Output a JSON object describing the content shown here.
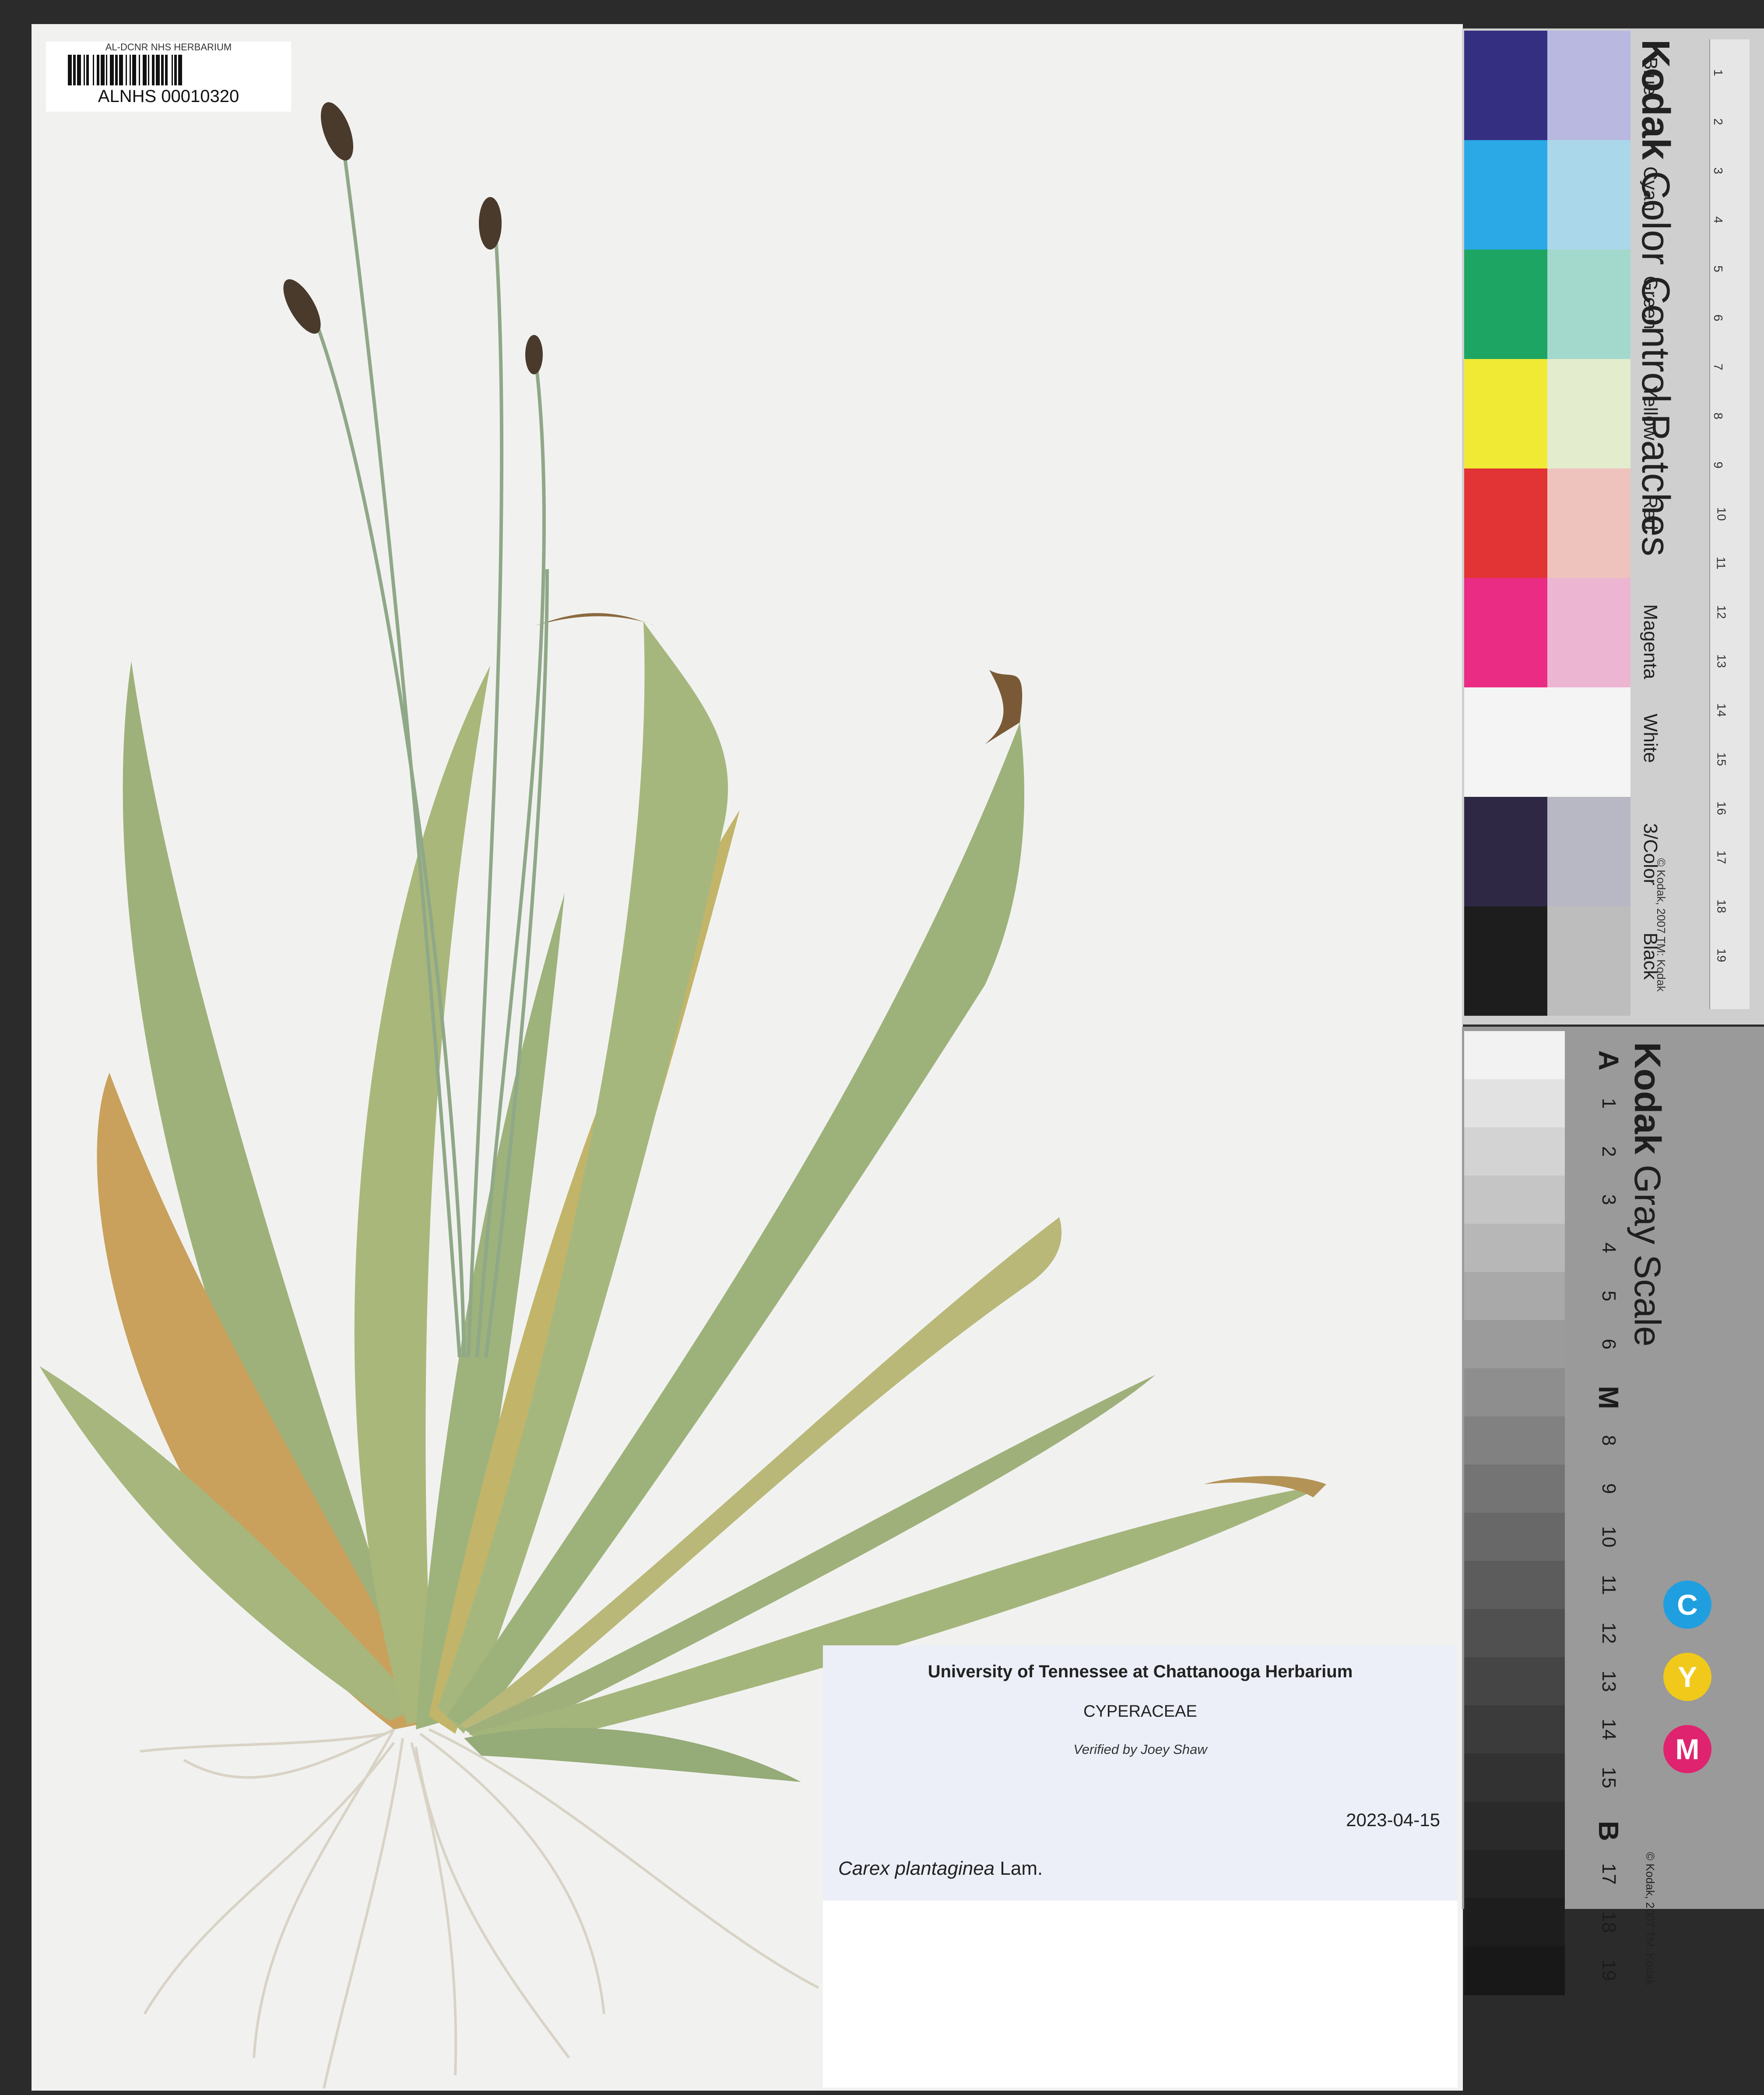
{
  "barcode": {
    "header": "AL-DCNR NHS HERBARIUM",
    "id": "ALNHS 00010320"
  },
  "label": {
    "institution": "University of Tennessee at Chattanooga Herbarium",
    "family": "CYPERACEAE",
    "verified": "Verified by Joey Shaw",
    "date": "2023-04-15",
    "name_italic": "Carex plantaginea",
    "author": "Lam."
  },
  "color_card": {
    "brand": "Kodak",
    "title": "Color Control Patches",
    "patches": [
      {
        "name": "Blue",
        "dark": "#352f82",
        "light": "#b9b8e0"
      },
      {
        "name": "Cyan",
        "dark": "#2aa9e6",
        "light": "#abd7ea"
      },
      {
        "name": "Green",
        "dark": "#1da663",
        "light": "#a3d9cd"
      },
      {
        "name": "Yellow",
        "dark": "#f1ea35",
        "light": "#e3eccc"
      },
      {
        "name": "Red",
        "dark": "#e23434",
        "light": "#efc3bd"
      },
      {
        "name": "Magenta",
        "dark": "#ea2c84",
        "light": "#ecb5d1"
      },
      {
        "name": "White",
        "dark": "#f4f4f4",
        "light": "#f4f4f4"
      },
      {
        "name": "3/Color",
        "dark": "#2f2845",
        "light": "#b7b8c4"
      },
      {
        "name": "Black",
        "dark": "#1d1d1d",
        "light": "#bdbdbd"
      }
    ],
    "ruler_numbers": [
      "1",
      "2",
      "3",
      "4",
      "5",
      "6",
      "7",
      "8",
      "9",
      "10",
      "11",
      "12",
      "13",
      "14",
      "15",
      "16",
      "17",
      "18",
      "19"
    ],
    "copyright": "© Kodak, 2007 TM: Kodak"
  },
  "gray_card": {
    "brand": "Kodak",
    "title": "Gray Scale",
    "steps": [
      "A",
      "1",
      "2",
      "3",
      "4",
      "5",
      "6",
      "M",
      "8",
      "9",
      "10",
      "11",
      "12",
      "13",
      "14",
      "15",
      "B",
      "17",
      "18",
      "19"
    ],
    "step_colors": [
      "#f2f2f2",
      "#e2e2e2",
      "#d3d3d3",
      "#c5c5c5",
      "#b7b7b7",
      "#a9a9a9",
      "#9b9b9b",
      "#8e8e8e",
      "#818181",
      "#747474",
      "#686868",
      "#5c5c5c",
      "#505050",
      "#454545",
      "#3b3b3b",
      "#323232",
      "#2a2a2a",
      "#232323",
      "#1d1d1d",
      "#181818"
    ],
    "cmy": [
      {
        "letter": "C",
        "color": "#1f9fe0"
      },
      {
        "letter": "Y",
        "color": "#f0c91a"
      },
      {
        "letter": "M",
        "color": "#e0236f"
      }
    ],
    "copyright": "© Kodak, 2007 TM: Kodak"
  }
}
